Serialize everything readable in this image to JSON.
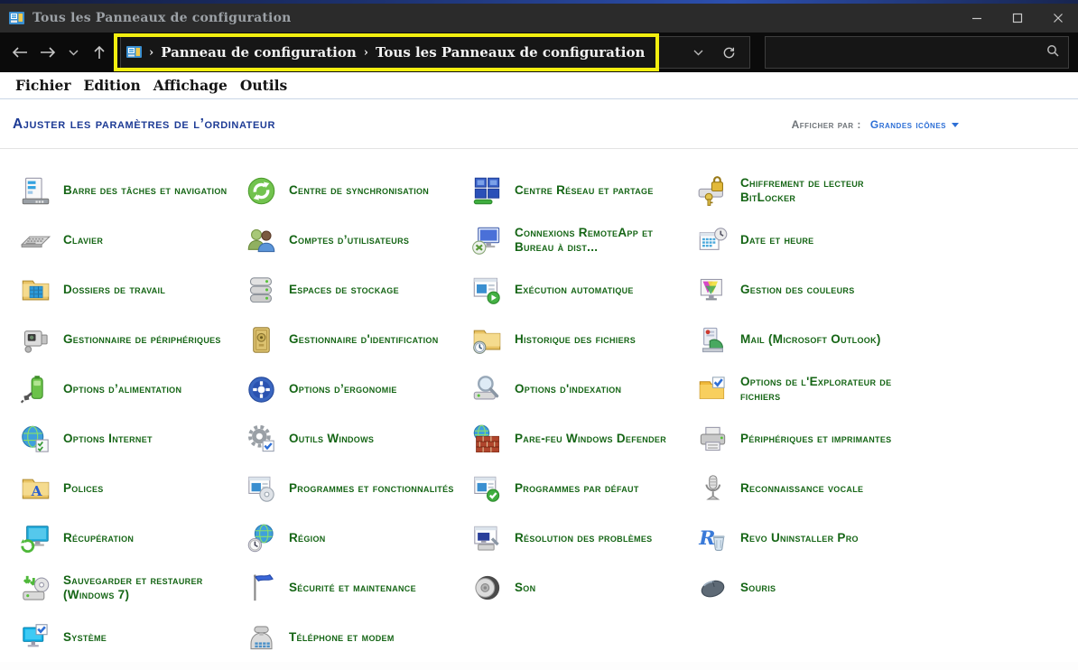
{
  "window": {
    "title": "Tous les Panneaux de configuration"
  },
  "navbar": {
    "breadcrumb": {
      "separator": "›",
      "items": [
        "Panneau de configuration",
        "Tous les Panneaux de configuration"
      ]
    },
    "search": {
      "value": "",
      "placeholder": ""
    }
  },
  "menubar": {
    "items": [
      "Fichier",
      "Edition",
      "Affichage",
      "Outils"
    ]
  },
  "header": {
    "title": "Ajuster les paramètres de l’ordinateur",
    "view_by_label": "Afficher par :",
    "view_by_value": "Grandes icônes"
  },
  "colors": {
    "item_text_green": "#156515",
    "heading_navy": "#1d3b95",
    "link_blue": "#2d6fd6",
    "highlight_yellow": "#f2ee10",
    "titlebar_bg": "#2b2b2b",
    "navbar_bg": "#0b0b0b"
  },
  "items": [
    {
      "id": "taskbar-navigation",
      "icon": "taskbar-navigation",
      "label": "Barre des tâches et navigation"
    },
    {
      "id": "sync-center",
      "icon": "sync-center",
      "label": "Centre de synchronisation"
    },
    {
      "id": "network-sharing",
      "icon": "network-sharing",
      "label": "Centre Réseau et partage"
    },
    {
      "id": "bitlocker",
      "icon": "bitlocker",
      "label": "Chiffrement de lecteur BitLocker"
    },
    {
      "id": "keyboard",
      "icon": "keyboard",
      "label": "Clavier"
    },
    {
      "id": "user-accounts",
      "icon": "user-accounts",
      "label": "Comptes d’utilisateurs"
    },
    {
      "id": "remoteapp",
      "icon": "remoteapp",
      "label": "Connexions RemoteApp et Bureau à dist..."
    },
    {
      "id": "date-time",
      "icon": "date-time",
      "label": "Date et heure"
    },
    {
      "id": "work-folders",
      "icon": "work-folders",
      "label": "Dossiers de travail"
    },
    {
      "id": "storage-spaces",
      "icon": "storage-spaces",
      "label": "Espaces de stockage"
    },
    {
      "id": "autoplay",
      "icon": "autoplay",
      "label": "Exécution automatique"
    },
    {
      "id": "color-management",
      "icon": "color-management",
      "label": "Gestion des couleurs"
    },
    {
      "id": "device-manager",
      "icon": "device-manager",
      "label": "Gestionnaire de périphériques"
    },
    {
      "id": "credential-manager",
      "icon": "credential-manager",
      "label": "Gestionnaire d'identification"
    },
    {
      "id": "file-history",
      "icon": "file-history",
      "label": "Historique des fichiers"
    },
    {
      "id": "mail",
      "icon": "mail",
      "label": "Mail (Microsoft Outlook)"
    },
    {
      "id": "power-options",
      "icon": "power-options",
      "label": "Options d’alimentation"
    },
    {
      "id": "ease-of-access",
      "icon": "ease-of-access",
      "label": "Options d’ergonomie"
    },
    {
      "id": "indexing-options",
      "icon": "indexing",
      "label": "Options d'indexation"
    },
    {
      "id": "folder-options",
      "icon": "folder-options",
      "label": "Options de l'Explorateur de fichiers"
    },
    {
      "id": "internet-options",
      "icon": "internet-options",
      "label": "Options Internet"
    },
    {
      "id": "windows-tools",
      "icon": "windows-tools",
      "label": "Outils Windows"
    },
    {
      "id": "firewall",
      "icon": "firewall",
      "label": "Pare-feu Windows Defender"
    },
    {
      "id": "devices-printers",
      "icon": "devices-printers",
      "label": "Périphériques et imprimantes"
    },
    {
      "id": "fonts",
      "icon": "fonts",
      "label": "Polices"
    },
    {
      "id": "programs-features",
      "icon": "programs-features",
      "label": "Programmes et fonctionnalités"
    },
    {
      "id": "default-programs",
      "icon": "default-programs",
      "label": "Programmes par défaut"
    },
    {
      "id": "speech-recognition",
      "icon": "speech",
      "label": "Reconnaissance vocale"
    },
    {
      "id": "recovery",
      "icon": "recovery",
      "label": "Récupération"
    },
    {
      "id": "region",
      "icon": "region",
      "label": "Région"
    },
    {
      "id": "troubleshooting",
      "icon": "troubleshooting",
      "label": "Résolution des problèmes"
    },
    {
      "id": "revo-uninstaller",
      "icon": "revo-uninstaller",
      "label": "Revo Uninstaller Pro"
    },
    {
      "id": "backup-restore",
      "icon": "backup-restore",
      "label": "Sauvegarder et restaurer (Windows 7)"
    },
    {
      "id": "security-maintenance",
      "icon": "security-maintenance",
      "label": "Sécurité et maintenance"
    },
    {
      "id": "sound",
      "icon": "sound",
      "label": "Son"
    },
    {
      "id": "mouse",
      "icon": "mouse",
      "label": "Souris"
    },
    {
      "id": "system",
      "icon": "system",
      "label": "Système"
    },
    {
      "id": "phone-modem",
      "icon": "phone-modem",
      "label": "Téléphone et modem"
    }
  ]
}
